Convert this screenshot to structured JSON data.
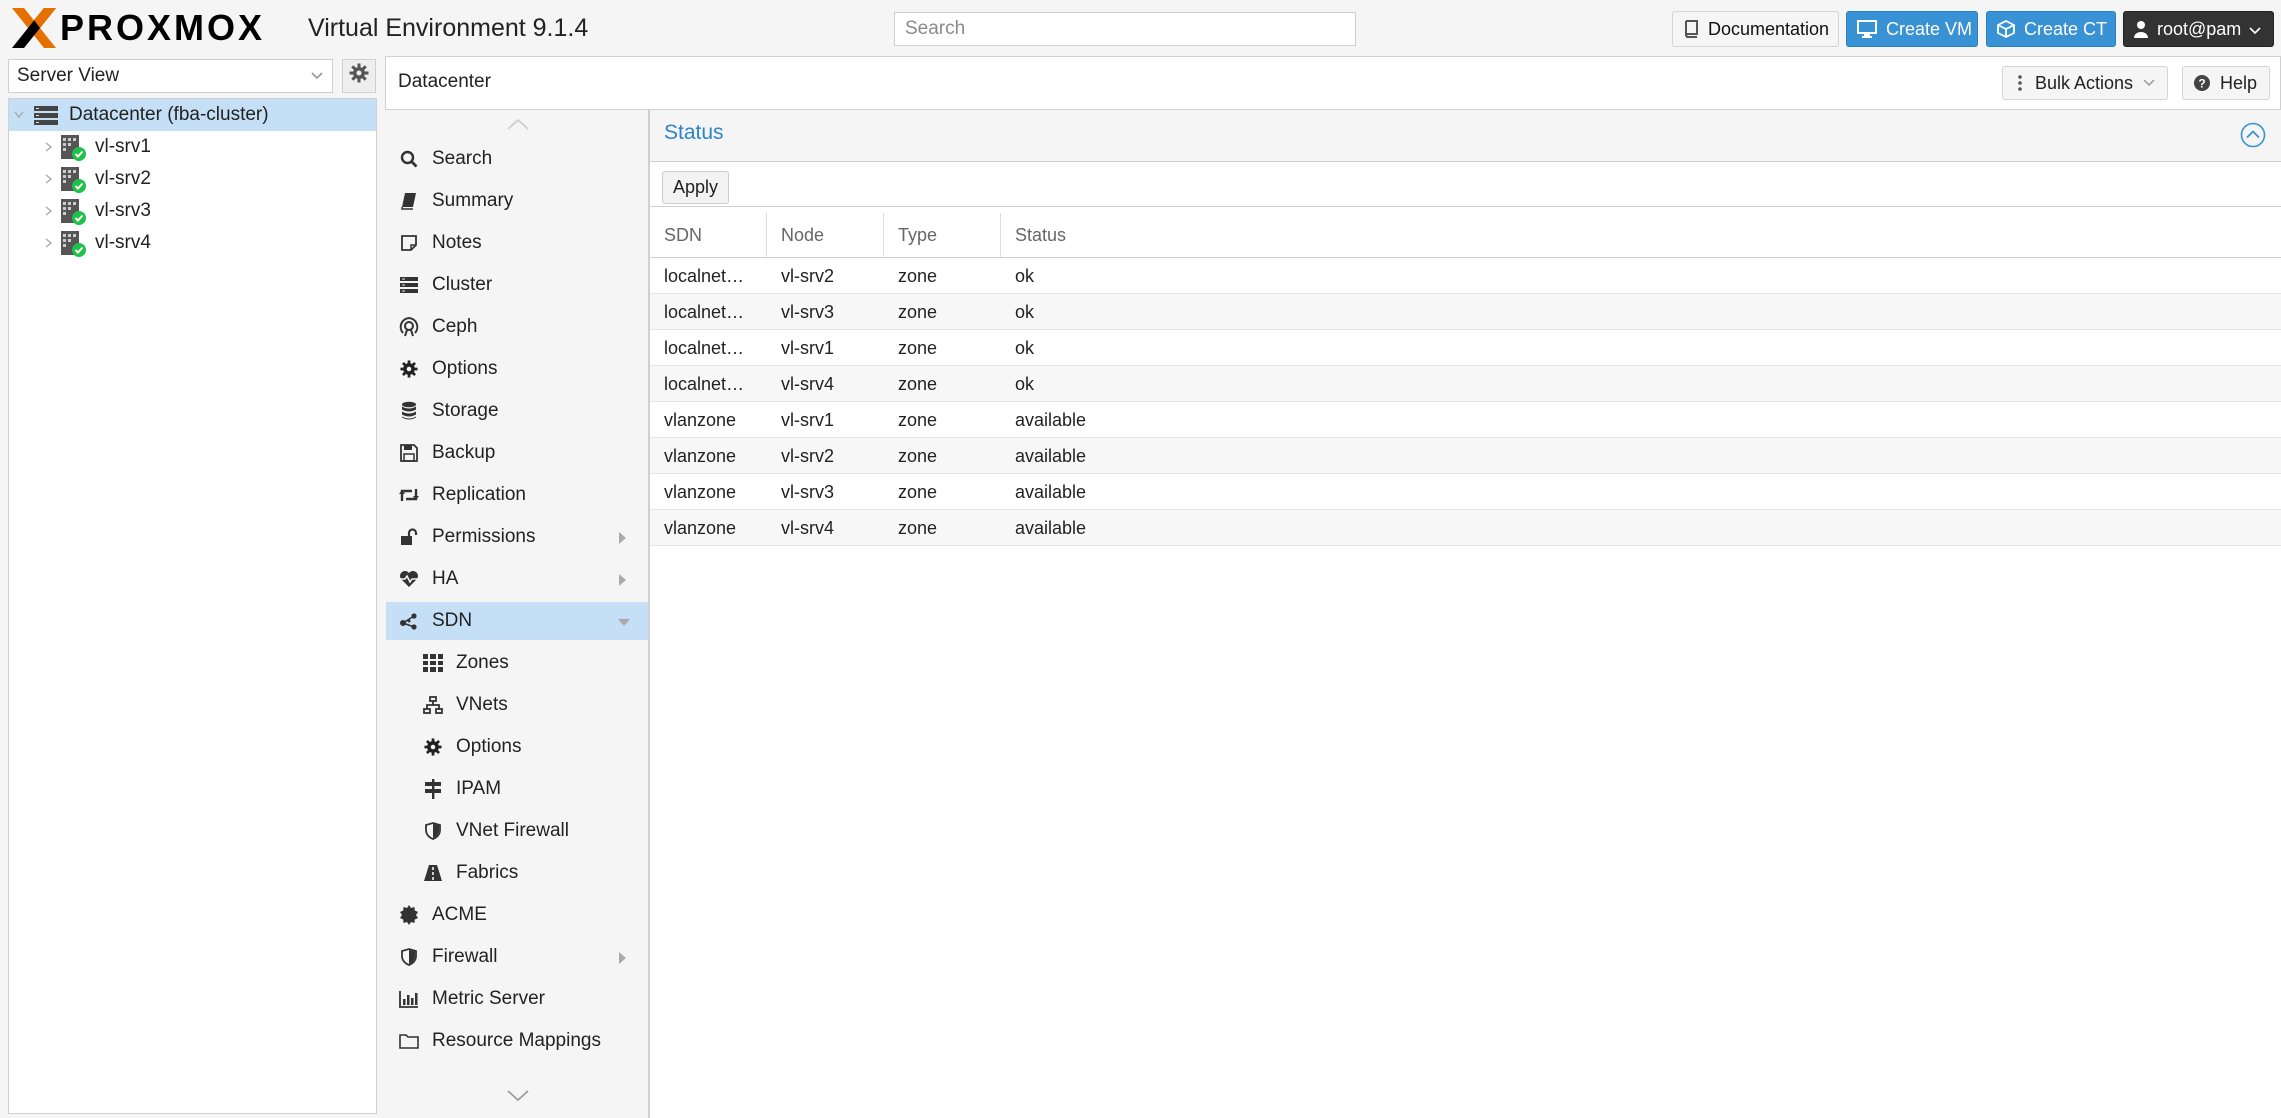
{
  "app": {
    "logo_text": "PROXMOX",
    "product_title": "Virtual Environment 9.1.4"
  },
  "topbar": {
    "search_placeholder": "Search",
    "docs_label": "Documentation",
    "create_vm_label": "Create VM",
    "create_ct_label": "Create CT",
    "user_label": "root@pam"
  },
  "tree": {
    "view_select": "Server View",
    "items": [
      {
        "label": "Datacenter (fba-cluster)",
        "icon": "datacenter-icon",
        "selected": true
      },
      {
        "label": "vl-srv1",
        "icon": "node-online-icon"
      },
      {
        "label": "vl-srv2",
        "icon": "node-online-icon"
      },
      {
        "label": "vl-srv3",
        "icon": "node-online-icon"
      },
      {
        "label": "vl-srv4",
        "icon": "node-online-icon"
      }
    ]
  },
  "header": {
    "breadcrumb": "Datacenter",
    "bulk_actions_label": "Bulk Actions",
    "help_label": "Help"
  },
  "menu": {
    "items": [
      {
        "label": "Search",
        "icon": "search-icon"
      },
      {
        "label": "Summary",
        "icon": "book-icon"
      },
      {
        "label": "Notes",
        "icon": "notes-icon"
      },
      {
        "label": "Cluster",
        "icon": "server-icon"
      },
      {
        "label": "Ceph",
        "icon": "ceph-icon"
      },
      {
        "label": "Options",
        "icon": "gear-icon"
      },
      {
        "label": "Storage",
        "icon": "database-icon"
      },
      {
        "label": "Backup",
        "icon": "floppy-icon"
      },
      {
        "label": "Replication",
        "icon": "retweet-icon"
      },
      {
        "label": "Permissions",
        "icon": "unlock-icon"
      },
      {
        "label": "HA",
        "icon": "heartbeat-icon"
      },
      {
        "label": "SDN",
        "icon": "sdn-icon"
      },
      {
        "label": "Zones",
        "icon": "th-icon"
      },
      {
        "label": "VNets",
        "icon": "sitemap-icon"
      },
      {
        "label": "Options",
        "icon": "gear-icon"
      },
      {
        "label": "IPAM",
        "icon": "signpost-icon"
      },
      {
        "label": "VNet Firewall",
        "icon": "shield-icon"
      },
      {
        "label": "Fabrics",
        "icon": "road-icon"
      },
      {
        "label": "ACME",
        "icon": "certificate-icon"
      },
      {
        "label": "Firewall",
        "icon": "shield-icon"
      },
      {
        "label": "Metric Server",
        "icon": "bar-chart-icon"
      },
      {
        "label": "Resource Mappings",
        "icon": "folder-icon"
      }
    ]
  },
  "panel": {
    "title": "Status",
    "apply_label": "Apply",
    "columns": [
      "SDN",
      "Node",
      "Type",
      "Status"
    ],
    "rows": [
      [
        "localnet…",
        "vl-srv2",
        "zone",
        "ok"
      ],
      [
        "localnet…",
        "vl-srv3",
        "zone",
        "ok"
      ],
      [
        "localnet…",
        "vl-srv1",
        "zone",
        "ok"
      ],
      [
        "localnet…",
        "vl-srv4",
        "zone",
        "ok"
      ],
      [
        "vlanzone",
        "vl-srv1",
        "zone",
        "available"
      ],
      [
        "vlanzone",
        "vl-srv2",
        "zone",
        "available"
      ],
      [
        "vlanzone",
        "vl-srv3",
        "zone",
        "available"
      ],
      [
        "vlanzone",
        "vl-srv4",
        "zone",
        "available"
      ]
    ]
  },
  "colors": {
    "accent": "#3892d4",
    "selection": "#c4dff6",
    "title_blue": "#2d83c9",
    "logo_orange": "#e57000",
    "status_green": "#21bf4b"
  }
}
